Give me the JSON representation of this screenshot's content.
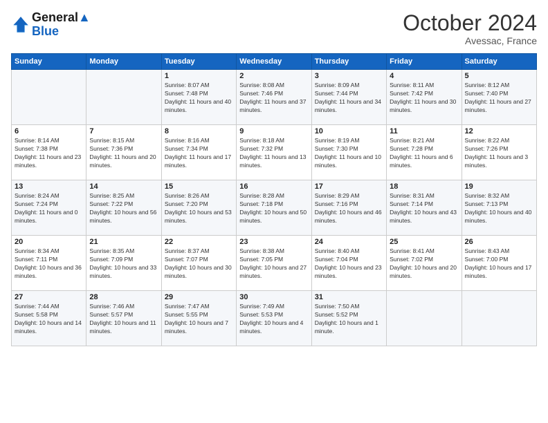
{
  "header": {
    "logo_line1": "General",
    "logo_line2": "Blue",
    "month": "October 2024",
    "location": "Avessac, France"
  },
  "weekdays": [
    "Sunday",
    "Monday",
    "Tuesday",
    "Wednesday",
    "Thursday",
    "Friday",
    "Saturday"
  ],
  "weeks": [
    [
      {
        "day": "",
        "sunrise": "",
        "sunset": "",
        "daylight": ""
      },
      {
        "day": "",
        "sunrise": "",
        "sunset": "",
        "daylight": ""
      },
      {
        "day": "1",
        "sunrise": "Sunrise: 8:07 AM",
        "sunset": "Sunset: 7:48 PM",
        "daylight": "Daylight: 11 hours and 40 minutes."
      },
      {
        "day": "2",
        "sunrise": "Sunrise: 8:08 AM",
        "sunset": "Sunset: 7:46 PM",
        "daylight": "Daylight: 11 hours and 37 minutes."
      },
      {
        "day": "3",
        "sunrise": "Sunrise: 8:09 AM",
        "sunset": "Sunset: 7:44 PM",
        "daylight": "Daylight: 11 hours and 34 minutes."
      },
      {
        "day": "4",
        "sunrise": "Sunrise: 8:11 AM",
        "sunset": "Sunset: 7:42 PM",
        "daylight": "Daylight: 11 hours and 30 minutes."
      },
      {
        "day": "5",
        "sunrise": "Sunrise: 8:12 AM",
        "sunset": "Sunset: 7:40 PM",
        "daylight": "Daylight: 11 hours and 27 minutes."
      }
    ],
    [
      {
        "day": "6",
        "sunrise": "Sunrise: 8:14 AM",
        "sunset": "Sunset: 7:38 PM",
        "daylight": "Daylight: 11 hours and 23 minutes."
      },
      {
        "day": "7",
        "sunrise": "Sunrise: 8:15 AM",
        "sunset": "Sunset: 7:36 PM",
        "daylight": "Daylight: 11 hours and 20 minutes."
      },
      {
        "day": "8",
        "sunrise": "Sunrise: 8:16 AM",
        "sunset": "Sunset: 7:34 PM",
        "daylight": "Daylight: 11 hours and 17 minutes."
      },
      {
        "day": "9",
        "sunrise": "Sunrise: 8:18 AM",
        "sunset": "Sunset: 7:32 PM",
        "daylight": "Daylight: 11 hours and 13 minutes."
      },
      {
        "day": "10",
        "sunrise": "Sunrise: 8:19 AM",
        "sunset": "Sunset: 7:30 PM",
        "daylight": "Daylight: 11 hours and 10 minutes."
      },
      {
        "day": "11",
        "sunrise": "Sunrise: 8:21 AM",
        "sunset": "Sunset: 7:28 PM",
        "daylight": "Daylight: 11 hours and 6 minutes."
      },
      {
        "day": "12",
        "sunrise": "Sunrise: 8:22 AM",
        "sunset": "Sunset: 7:26 PM",
        "daylight": "Daylight: 11 hours and 3 minutes."
      }
    ],
    [
      {
        "day": "13",
        "sunrise": "Sunrise: 8:24 AM",
        "sunset": "Sunset: 7:24 PM",
        "daylight": "Daylight: 11 hours and 0 minutes."
      },
      {
        "day": "14",
        "sunrise": "Sunrise: 8:25 AM",
        "sunset": "Sunset: 7:22 PM",
        "daylight": "Daylight: 10 hours and 56 minutes."
      },
      {
        "day": "15",
        "sunrise": "Sunrise: 8:26 AM",
        "sunset": "Sunset: 7:20 PM",
        "daylight": "Daylight: 10 hours and 53 minutes."
      },
      {
        "day": "16",
        "sunrise": "Sunrise: 8:28 AM",
        "sunset": "Sunset: 7:18 PM",
        "daylight": "Daylight: 10 hours and 50 minutes."
      },
      {
        "day": "17",
        "sunrise": "Sunrise: 8:29 AM",
        "sunset": "Sunset: 7:16 PM",
        "daylight": "Daylight: 10 hours and 46 minutes."
      },
      {
        "day": "18",
        "sunrise": "Sunrise: 8:31 AM",
        "sunset": "Sunset: 7:14 PM",
        "daylight": "Daylight: 10 hours and 43 minutes."
      },
      {
        "day": "19",
        "sunrise": "Sunrise: 8:32 AM",
        "sunset": "Sunset: 7:13 PM",
        "daylight": "Daylight: 10 hours and 40 minutes."
      }
    ],
    [
      {
        "day": "20",
        "sunrise": "Sunrise: 8:34 AM",
        "sunset": "Sunset: 7:11 PM",
        "daylight": "Daylight: 10 hours and 36 minutes."
      },
      {
        "day": "21",
        "sunrise": "Sunrise: 8:35 AM",
        "sunset": "Sunset: 7:09 PM",
        "daylight": "Daylight: 10 hours and 33 minutes."
      },
      {
        "day": "22",
        "sunrise": "Sunrise: 8:37 AM",
        "sunset": "Sunset: 7:07 PM",
        "daylight": "Daylight: 10 hours and 30 minutes."
      },
      {
        "day": "23",
        "sunrise": "Sunrise: 8:38 AM",
        "sunset": "Sunset: 7:05 PM",
        "daylight": "Daylight: 10 hours and 27 minutes."
      },
      {
        "day": "24",
        "sunrise": "Sunrise: 8:40 AM",
        "sunset": "Sunset: 7:04 PM",
        "daylight": "Daylight: 10 hours and 23 minutes."
      },
      {
        "day": "25",
        "sunrise": "Sunrise: 8:41 AM",
        "sunset": "Sunset: 7:02 PM",
        "daylight": "Daylight: 10 hours and 20 minutes."
      },
      {
        "day": "26",
        "sunrise": "Sunrise: 8:43 AM",
        "sunset": "Sunset: 7:00 PM",
        "daylight": "Daylight: 10 hours and 17 minutes."
      }
    ],
    [
      {
        "day": "27",
        "sunrise": "Sunrise: 7:44 AM",
        "sunset": "Sunset: 5:58 PM",
        "daylight": "Daylight: 10 hours and 14 minutes."
      },
      {
        "day": "28",
        "sunrise": "Sunrise: 7:46 AM",
        "sunset": "Sunset: 5:57 PM",
        "daylight": "Daylight: 10 hours and 11 minutes."
      },
      {
        "day": "29",
        "sunrise": "Sunrise: 7:47 AM",
        "sunset": "Sunset: 5:55 PM",
        "daylight": "Daylight: 10 hours and 7 minutes."
      },
      {
        "day": "30",
        "sunrise": "Sunrise: 7:49 AM",
        "sunset": "Sunset: 5:53 PM",
        "daylight": "Daylight: 10 hours and 4 minutes."
      },
      {
        "day": "31",
        "sunrise": "Sunrise: 7:50 AM",
        "sunset": "Sunset: 5:52 PM",
        "daylight": "Daylight: 10 hours and 1 minute."
      },
      {
        "day": "",
        "sunrise": "",
        "sunset": "",
        "daylight": ""
      },
      {
        "day": "",
        "sunrise": "",
        "sunset": "",
        "daylight": ""
      }
    ]
  ]
}
